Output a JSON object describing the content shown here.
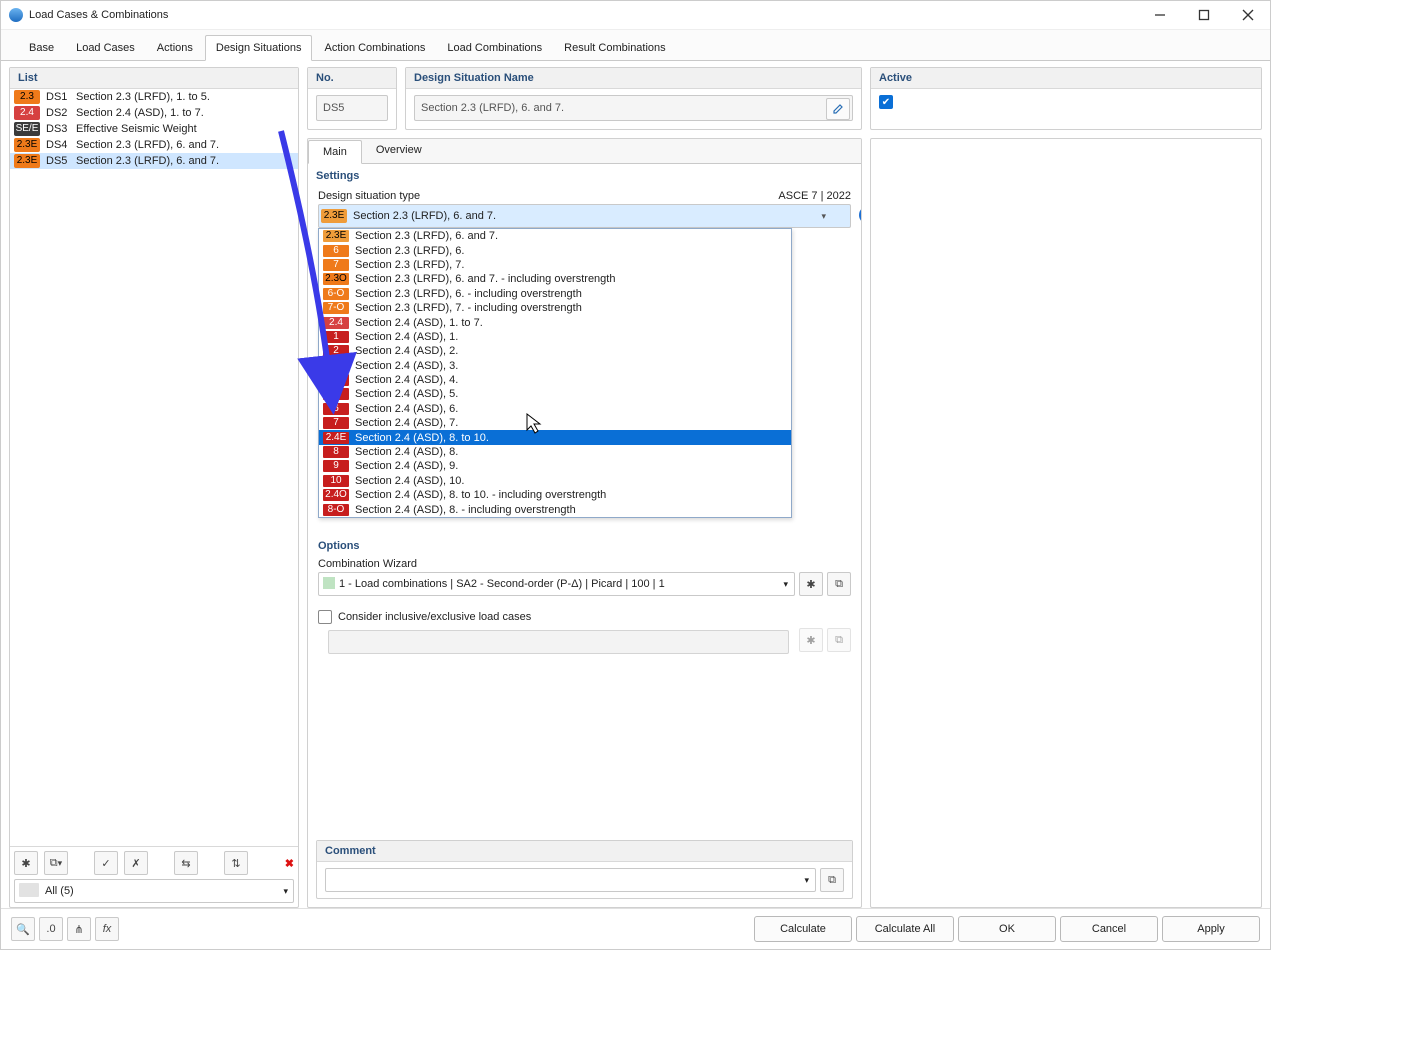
{
  "window": {
    "title": "Load Cases & Combinations"
  },
  "tabs": [
    "Base",
    "Load Cases",
    "Actions",
    "Design Situations",
    "Action Combinations",
    "Load Combinations",
    "Result Combinations"
  ],
  "active_tab_index": 3,
  "left": {
    "header": "List",
    "rows": [
      {
        "badge": "2.3",
        "bg": "#ef7a1a",
        "fg": "#000",
        "ds": "DS1",
        "name": "Section 2.3 (LRFD), 1. to 5."
      },
      {
        "badge": "2.4",
        "bg": "#d64040",
        "fg": "#fff",
        "ds": "DS2",
        "name": "Section 2.4 (ASD), 1. to 7."
      },
      {
        "badge": "SE/E",
        "bg": "#3b3b3b",
        "fg": "#fff",
        "ds": "DS3",
        "name": "Effective Seismic Weight"
      },
      {
        "badge": "2.3E",
        "bg": "#ef7a1a",
        "fg": "#000",
        "ds": "DS4",
        "name": "Section 2.3 (LRFD), 6. and 7."
      },
      {
        "badge": "2.3E",
        "bg": "#ef7a1a",
        "fg": "#000",
        "ds": "DS5",
        "name": "Section 2.3 (LRFD), 6. and 7."
      }
    ],
    "selected_index": 4,
    "filter": "All (5)"
  },
  "detail": {
    "no_header": "No.",
    "no_value": "DS5",
    "name_header": "Design Situation Name",
    "name_value": "Section 2.3 (LRFD), 6. and 7.",
    "active_header": "Active",
    "inner_tabs": [
      "Main",
      "Overview"
    ],
    "inner_active": 0,
    "settings_label": "Settings",
    "type_label": "Design situation type",
    "type_code": "ASCE 7 | 2022",
    "dd_selected": {
      "badge": "2.3E",
      "bg": "#ef9c3a",
      "fg": "#000",
      "label": "Section 2.3 (LRFD), 6. and 7."
    },
    "dd_options": [
      {
        "badge": "2.3E",
        "bg": "#ef9c3a",
        "fg": "#000",
        "label": "Section 2.3 (LRFD), 6. and 7."
      },
      {
        "badge": "6",
        "bg": "#ef7a1a",
        "fg": "#fff",
        "label": "Section 2.3 (LRFD), 6."
      },
      {
        "badge": "7",
        "bg": "#ef7a1a",
        "fg": "#fff",
        "label": "Section 2.3 (LRFD), 7."
      },
      {
        "badge": "2.3O",
        "bg": "#ef7a1a",
        "fg": "#000",
        "label": "Section 2.3 (LRFD), 6. and 7. - including overstrength"
      },
      {
        "badge": "6-O",
        "bg": "#ef7a1a",
        "fg": "#fff",
        "label": "Section 2.3 (LRFD), 6. - including overstrength"
      },
      {
        "badge": "7-O",
        "bg": "#ef7a1a",
        "fg": "#fff",
        "label": "Section 2.3 (LRFD), 7. - including overstrength"
      },
      {
        "badge": "2.4",
        "bg": "#d64040",
        "fg": "#fff",
        "label": "Section 2.4 (ASD), 1. to 7."
      },
      {
        "badge": "1",
        "bg": "#c71e1e",
        "fg": "#fff",
        "label": "Section 2.4 (ASD), 1."
      },
      {
        "badge": "2",
        "bg": "#c71e1e",
        "fg": "#fff",
        "label": "Section 2.4 (ASD), 2."
      },
      {
        "badge": "3",
        "bg": "#c71e1e",
        "fg": "#fff",
        "label": "Section 2.4 (ASD), 3."
      },
      {
        "badge": "4",
        "bg": "#c71e1e",
        "fg": "#fff",
        "label": "Section 2.4 (ASD), 4."
      },
      {
        "badge": "5",
        "bg": "#c71e1e",
        "fg": "#fff",
        "label": "Section 2.4 (ASD), 5."
      },
      {
        "badge": "6",
        "bg": "#c71e1e",
        "fg": "#fff",
        "label": "Section 2.4 (ASD), 6."
      },
      {
        "badge": "7",
        "bg": "#c71e1e",
        "fg": "#fff",
        "label": "Section 2.4 (ASD), 7."
      },
      {
        "badge": "2.4E",
        "bg": "#c71e1e",
        "fg": "#fff",
        "label": "Section 2.4 (ASD), 8. to 10.",
        "highlight": true
      },
      {
        "badge": "8",
        "bg": "#c71e1e",
        "fg": "#fff",
        "label": "Section 2.4 (ASD), 8."
      },
      {
        "badge": "9",
        "bg": "#c71e1e",
        "fg": "#fff",
        "label": "Section 2.4 (ASD), 9."
      },
      {
        "badge": "10",
        "bg": "#c71e1e",
        "fg": "#fff",
        "label": "Section 2.4 (ASD), 10."
      },
      {
        "badge": "2.4O",
        "bg": "#c71e1e",
        "fg": "#fff",
        "label": "Section 2.4 (ASD), 8. to 10. - including overstrength"
      },
      {
        "badge": "8-O",
        "bg": "#c71e1e",
        "fg": "#fff",
        "label": "Section 2.4 (ASD), 8. - including overstrength"
      }
    ],
    "options_label": "Options",
    "cw_label": "Combination Wizard",
    "cw_value": "1 - Load combinations | SA2 - Second-order (P-Δ) | Picard | 100 | 1",
    "check_label": "Consider inclusive/exclusive load cases",
    "comment_header": "Comment"
  },
  "footer": {
    "calculate": "Calculate",
    "calculate_all": "Calculate All",
    "ok": "OK",
    "cancel": "Cancel",
    "apply": "Apply"
  }
}
